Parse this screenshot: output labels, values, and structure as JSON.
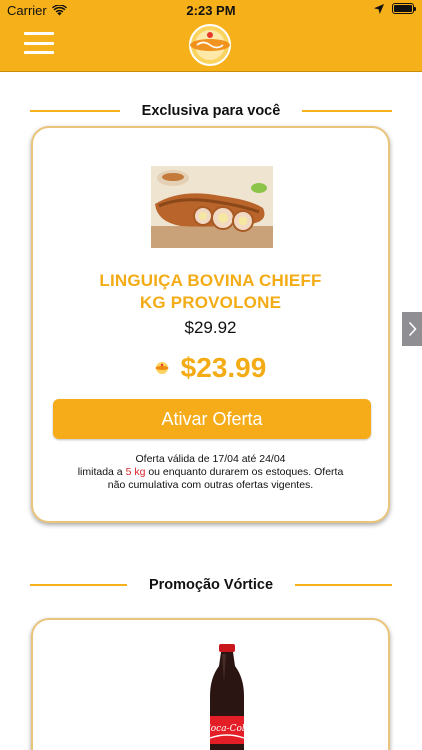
{
  "status_bar": {
    "carrier": "Carrier",
    "time": "2:23 PM"
  },
  "header": {
    "menu_icon": "hamburger-menu-icon",
    "logo_icon": "brand-logo"
  },
  "sections": [
    {
      "title": "Exclusiva para você",
      "product": {
        "name_line1": "LINGUIÇA BOVINA CHIEFF",
        "name_line2": "KG PROVOLONE",
        "old_price": "$29.92",
        "new_price": "$23.99",
        "button_label": "Ativar Oferta",
        "terms_line1": "Oferta válida de 17/04 até 24/04",
        "terms_prefix": "limitada a ",
        "terms_limit": "5 kg",
        "terms_suffix": " ou enquanto durarem os estoques. Oferta",
        "terms_line3": "não cumulativa com outras ofertas vigentes."
      }
    },
    {
      "title": "Promoção Vórtice",
      "product": {
        "image_icon": "coca-cola-bottle-image",
        "brand_label": "Coca-Cola"
      }
    }
  ],
  "colors": {
    "brand_yellow": "#f6b01a",
    "price_yellow": "#f3ac16",
    "limit_red": "#d8292f"
  }
}
